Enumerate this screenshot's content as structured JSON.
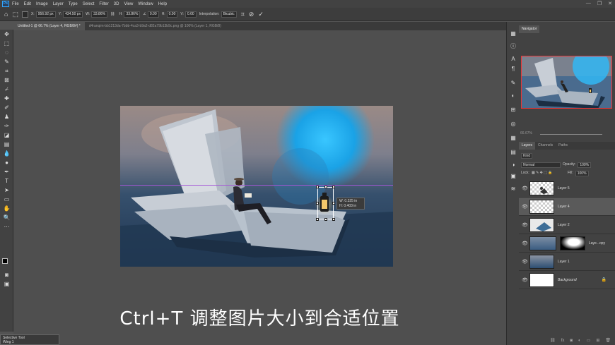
{
  "app": {
    "logo": "Ps",
    "window_controls": [
      "—",
      "❐",
      "✕"
    ]
  },
  "menu": [
    "File",
    "Edit",
    "Image",
    "Layer",
    "Type",
    "Select",
    "Filter",
    "3D",
    "View",
    "Window",
    "Help"
  ],
  "options": {
    "x_label": "X:",
    "x_value": "956.92 px",
    "y_label": "Y:",
    "y_value": "434.50 px",
    "w_label": "W:",
    "w_value": "33.86%",
    "h_label": "H:",
    "h_value": "33.86%",
    "angle_value": "0.00",
    "hskew_label": "H:",
    "hskew_value": "0.00",
    "vskew_label": "V:",
    "vskew_value": "0.00",
    "interp_label": "Interpolation:",
    "interp_value": "Bicubic"
  },
  "tabs": [
    {
      "label": "Untitled-1 @ 66.7% (Layer 4, RGB/8#) *",
      "active": true
    },
    {
      "label": "d4ranqim-bb1213da-7bbb-4ca3-b9a2-d82a79b13b9c.png @ 100% (Layer 1, RGB/8)",
      "active": false
    }
  ],
  "transform_readout": {
    "w_line": "W: 0.325 in",
    "h_line": "H: 0.403 in"
  },
  "subtitle": "Ctrl+T 调整图片大小到合适位置",
  "panels": {
    "navigator_tab": "Navigator",
    "zoom_value": "66.67%",
    "layer_tabs": [
      "Layers",
      "Channels",
      "Paths"
    ],
    "kind_label": "Kind",
    "blend_mode": "Normal",
    "opacity_label": "Opacity:",
    "opacity_value": "100%",
    "lock_label": "Lock:",
    "fill_label": "Fill:",
    "fill_value": "100%",
    "layers": [
      {
        "name": "Layer 5"
      },
      {
        "name": "Layer 4"
      },
      {
        "name": "Layer 2"
      },
      {
        "name": "Laye...opy"
      },
      {
        "name": "Layer 1"
      },
      {
        "name": "Background"
      }
    ]
  },
  "selective_tool": {
    "title": "Selective Tool",
    "item": "Wing 1"
  },
  "colors": {
    "accent_blue": "#31a8ff",
    "guide": "#a557d6",
    "nav_frame": "#e33333"
  }
}
